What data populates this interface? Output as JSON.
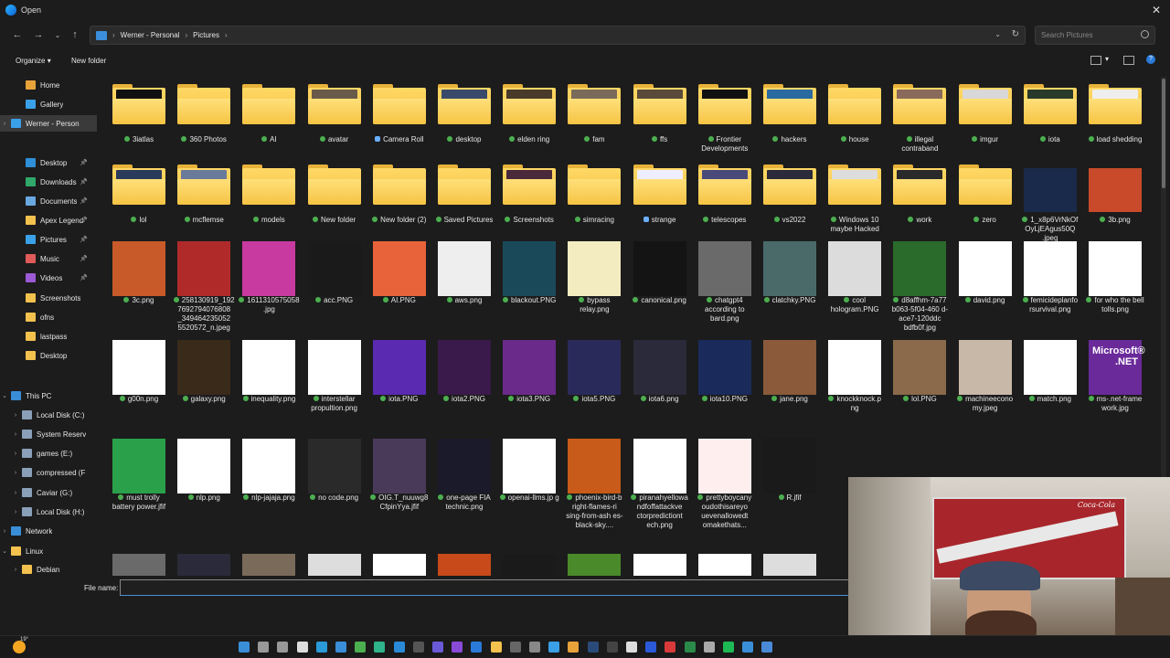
{
  "window": {
    "title": "Open"
  },
  "address": {
    "crumbs": [
      "Werner - Personal",
      "Pictures"
    ],
    "search_placeholder": "Search Pictures"
  },
  "commands": {
    "organize": "Organize",
    "new_folder": "New folder"
  },
  "nav": [
    {
      "label": "Home",
      "icon": "home-icon",
      "color": "#e8a23a"
    },
    {
      "label": "Gallery",
      "icon": "gallery-icon",
      "color": "#3aa0e8"
    },
    {
      "label": "Werner - Person",
      "icon": "cloud-icon",
      "color": "#3aa0e8",
      "selected": true,
      "expandable": true
    },
    {
      "label": "Desktop",
      "icon": "desktop-icon",
      "color": "#2f8fd8",
      "pinned": true
    },
    {
      "label": "Downloads",
      "icon": "downloads-icon",
      "color": "#2fa86a",
      "pinned": true
    },
    {
      "label": "Documents",
      "icon": "documents-icon",
      "color": "#6aa8e0",
      "pinned": true
    },
    {
      "label": "Apex Legend",
      "icon": "folder-icon",
      "color": "#f2c14e",
      "pinned": true
    },
    {
      "label": "Pictures",
      "icon": "pictures-icon",
      "color": "#3aa0e8",
      "pinned": true
    },
    {
      "label": "Music",
      "icon": "music-icon",
      "color": "#e05a5a",
      "pinned": true
    },
    {
      "label": "Videos",
      "icon": "videos-icon",
      "color": "#9b59d6",
      "pinned": true
    },
    {
      "label": "Screenshots",
      "icon": "folder-icon",
      "color": "#f2c14e"
    },
    {
      "label": "ofns",
      "icon": "folder-icon",
      "color": "#f2c14e"
    },
    {
      "label": "lastpass",
      "icon": "folder-icon",
      "color": "#f2c14e"
    },
    {
      "label": "Desktop",
      "icon": "folder-icon",
      "color": "#f2c14e"
    },
    {
      "label": "This PC",
      "icon": "pc-icon",
      "color": "#3a8ed8",
      "expanded": true
    },
    {
      "label": "Local Disk (C:)",
      "icon": "drive-icon",
      "color": "#8aa0b8",
      "expandable": true,
      "indent": true
    },
    {
      "label": "System Reserv",
      "icon": "drive-icon",
      "color": "#8aa0b8",
      "expandable": true,
      "indent": true
    },
    {
      "label": "games (E:)",
      "icon": "drive-icon",
      "color": "#8aa0b8",
      "expandable": true,
      "indent": true
    },
    {
      "label": "compressed (F",
      "icon": "drive-icon",
      "color": "#8aa0b8",
      "expandable": true,
      "indent": true
    },
    {
      "label": "Caviar (G:)",
      "icon": "drive-icon",
      "color": "#8aa0b8",
      "expandable": true,
      "indent": true
    },
    {
      "label": "Local Disk (H:)",
      "icon": "drive-icon",
      "color": "#8aa0b8",
      "expandable": true,
      "indent": true
    },
    {
      "label": "Network",
      "icon": "network-icon",
      "color": "#3a8ed8",
      "expandable": true
    },
    {
      "label": "Linux",
      "icon": "linux-icon",
      "color": "#f2c14e",
      "expanded": true
    },
    {
      "label": "Debian",
      "icon": "folder-icon",
      "color": "#f2c14e",
      "expandable": true,
      "indent": true
    }
  ],
  "items": [
    {
      "label": "3iatlas",
      "kind": "folder",
      "preview": "#111",
      "sync": "ok"
    },
    {
      "label": "360 Photos",
      "kind": "folder",
      "sync": "ok"
    },
    {
      "label": "AI",
      "kind": "folder",
      "sync": "ok"
    },
    {
      "label": "avatar",
      "kind": "folder",
      "preview": "#6a5a4a",
      "sync": "ok"
    },
    {
      "label": "Camera Roll",
      "kind": "folder",
      "sync": "cloud"
    },
    {
      "label": "desktop",
      "kind": "folder",
      "preview": "#3a4a6a",
      "sync": "ok"
    },
    {
      "label": "elden ring",
      "kind": "folder",
      "preview": "#4a3a2a",
      "sync": "ok"
    },
    {
      "label": "fam",
      "kind": "folder",
      "preview": "#7a6a5a",
      "sync": "ok"
    },
    {
      "label": "ffs",
      "kind": "folder",
      "preview": "#5a4a3a",
      "sync": "ok"
    },
    {
      "label": "Frontier Developments",
      "kind": "folder",
      "preview": "#111",
      "sync": "ok"
    },
    {
      "label": "hackers",
      "kind": "folder",
      "preview": "#2a6aa0",
      "sync": "ok"
    },
    {
      "label": "house",
      "kind": "folder",
      "sync": "ok"
    },
    {
      "label": "illegal contraband",
      "kind": "folder",
      "preview": "#8a6a5a",
      "sync": "ok"
    },
    {
      "label": "imgur",
      "kind": "folder",
      "preview": "#d8d8d8",
      "sync": "ok"
    },
    {
      "label": "iota",
      "kind": "folder",
      "preview": "#2a3a2a",
      "sync": "ok"
    },
    {
      "label": "load shedding",
      "kind": "folder",
      "preview": "#eee",
      "sync": "ok"
    },
    {
      "label": "lol",
      "kind": "folder",
      "preview": "#2a3a5a",
      "sync": "ok"
    },
    {
      "label": "mcflemse",
      "kind": "folder",
      "preview": "#6a7a9a",
      "sync": "ok"
    },
    {
      "label": "models",
      "kind": "folder",
      "sync": "ok"
    },
    {
      "label": "New folder",
      "kind": "folder",
      "sync": "ok"
    },
    {
      "label": "New folder (2)",
      "kind": "folder",
      "sync": "ok"
    },
    {
      "label": "Saved Pictures",
      "kind": "folder",
      "sync": "ok"
    },
    {
      "label": "Screenshots",
      "kind": "folder",
      "preview": "#4a2a3a",
      "sync": "ok"
    },
    {
      "label": "simracing",
      "kind": "folder",
      "sync": "ok"
    },
    {
      "label": "strange",
      "kind": "folder",
      "preview": "#eef",
      "sync": "cloud"
    },
    {
      "label": "telescopes",
      "kind": "folder",
      "preview": "#4a4a7a",
      "sync": "ok"
    },
    {
      "label": "vs2022",
      "kind": "folder",
      "preview": "#2a2a3a",
      "sync": "ok"
    },
    {
      "label": "Windows 10 maybe Hacked",
      "kind": "folder",
      "preview": "#ddd",
      "sync": "ok"
    },
    {
      "label": "work",
      "kind": "folder",
      "preview": "#2a2a2a",
      "sync": "ok"
    },
    {
      "label": "zero",
      "kind": "folder",
      "sync": "ok"
    },
    {
      "label": "1_x8p6VrNkOf OyLjEAgus50Q .jpeg",
      "kind": "image",
      "color": "#1a2a4a",
      "sync": "ok"
    },
    {
      "label": "3b.png",
      "kind": "image",
      "color": "#c84a2a",
      "sync": "ok"
    },
    {
      "label": "3c.png",
      "kind": "image",
      "color": "#c85a2a",
      "sync": "ok"
    },
    {
      "label": "258130919_192 7692794076808 _349464235052 5520572_n.jpeg",
      "kind": "image",
      "color": "#b02a2a",
      "sync": "ok"
    },
    {
      "label": "1611310575058 .jpg",
      "kind": "image",
      "color": "#c83aa0",
      "sync": "ok"
    },
    {
      "label": "acc.PNG",
      "kind": "image",
      "color": "#1a1a1a",
      "sync": "ok"
    },
    {
      "label": "AI.PNG",
      "kind": "image",
      "color": "#e8623a",
      "sync": "ok"
    },
    {
      "label": "aws.png",
      "kind": "image",
      "color": "#eeeeee",
      "sync": "ok"
    },
    {
      "label": "blackout.PNG",
      "kind": "image",
      "color": "#1a4a5a",
      "sync": "ok"
    },
    {
      "label": "bypass relay.png",
      "kind": "image",
      "color": "#f2ecc0",
      "sync": "ok"
    },
    {
      "label": "canonical.png",
      "kind": "image",
      "color": "#141414",
      "sync": "ok"
    },
    {
      "label": "chatgpt4 according to bard.png",
      "kind": "image",
      "color": "#6a6a6a",
      "sync": "ok"
    },
    {
      "label": "clatchky.PNG",
      "kind": "image",
      "color": "#4a6a6a",
      "sync": "ok"
    },
    {
      "label": "cool hologram.PNG",
      "kind": "image",
      "color": "#dcdcdc",
      "sync": "ok"
    },
    {
      "label": "d8affhm-7a77 b063-5f04-460 d-ace7-120ddc bdfb0f.jpg",
      "kind": "image",
      "color": "#2a6a2a",
      "sync": "ok"
    },
    {
      "label": "david.png",
      "kind": "image",
      "color": "#ffffff",
      "sync": "ok"
    },
    {
      "label": "femicideplanfo rsurvival.png",
      "kind": "image",
      "color": "#ffffff",
      "sync": "ok"
    },
    {
      "label": "for who the bell tolls.png",
      "kind": "image",
      "color": "#ffffff",
      "sync": "ok"
    },
    {
      "label": "g00n.png",
      "kind": "image",
      "color": "#ffffff",
      "sync": "ok"
    },
    {
      "label": "galaxy.png",
      "kind": "image",
      "color": "#3a2a1a",
      "sync": "ok"
    },
    {
      "label": "inequality.png",
      "kind": "image",
      "color": "#ffffff",
      "sync": "ok"
    },
    {
      "label": "interstellar propultion.png",
      "kind": "image",
      "color": "#ffffff",
      "sync": "ok"
    },
    {
      "label": "iota.PNG",
      "kind": "image",
      "color": "#5a2ab0",
      "sync": "ok"
    },
    {
      "label": "iota2.PNG",
      "kind": "image",
      "color": "#3a1a4a",
      "sync": "ok"
    },
    {
      "label": "iota3.PNG",
      "kind": "image",
      "color": "#6a2a8a",
      "sync": "ok"
    },
    {
      "label": "iota5.PNG",
      "kind": "image",
      "color": "#2a2a5a",
      "sync": "ok"
    },
    {
      "label": "iota6.png",
      "kind": "image",
      "color": "#2a2a3a",
      "sync": "ok"
    },
    {
      "label": "iota10.PNG",
      "kind": "image",
      "color": "#1a2a5a",
      "sync": "ok"
    },
    {
      "label": "jane.png",
      "kind": "image",
      "color": "#8a5a3a",
      "sync": "ok"
    },
    {
      "label": "knockknock.p ng",
      "kind": "image",
      "color": "#ffffff",
      "sync": "ok"
    },
    {
      "label": "lol.PNG",
      "kind": "image",
      "color": "#8a6a4a",
      "sync": "ok"
    },
    {
      "label": "machineecono my.jpeg",
      "kind": "image",
      "color": "#c8b8a8",
      "sync": "ok"
    },
    {
      "label": "match.png",
      "kind": "image",
      "color": "#ffffff",
      "sync": "ok"
    },
    {
      "label": "ms-.net-frame work.jpg",
      "kind": "image",
      "color": "#6a2a9a",
      "sync": "ok",
      "thumb_text": "Microsoft® .NET"
    },
    {
      "label": "must trolly battery power.jfif",
      "kind": "image",
      "color": "#2aa04a",
      "sync": "ok"
    },
    {
      "label": "nlp.png",
      "kind": "image",
      "color": "#ffffff",
      "sync": "ok"
    },
    {
      "label": "nlp-jajaja.png",
      "kind": "image",
      "color": "#ffffff",
      "sync": "ok"
    },
    {
      "label": "no code.png",
      "kind": "image",
      "color": "#2a2a2a",
      "sync": "ok"
    },
    {
      "label": "OIG.T_nuuwg8 CfpinYya.jfif",
      "kind": "image",
      "color": "#4a3a5a",
      "sync": "ok"
    },
    {
      "label": "one-page FIA technic.png",
      "kind": "image",
      "color": "#1a1a2a",
      "sync": "ok"
    },
    {
      "label": "openai-llms.jp g",
      "kind": "image",
      "color": "#ffffff",
      "sync": "ok"
    },
    {
      "label": "phoenix-bird-b right-flames-ri sing-from-ash es-black-sky....",
      "kind": "image",
      "color": "#c85a1a",
      "sync": "ok"
    },
    {
      "label": "piranahyellowa ndfoffattackve ctorpredictiont ech.png",
      "kind": "image",
      "color": "#ffffff",
      "sync": "ok"
    },
    {
      "label": "prettyboycany oudothisareyo uevenallowedt omakethats...",
      "kind": "image",
      "color": "#ffeeee",
      "sync": "ok"
    },
    {
      "label": "R.jfif",
      "kind": "image",
      "color": "#1a1a1a",
      "sync": "ok"
    },
    {
      "label": "",
      "kind": "image",
      "color": "#6a6a6a"
    },
    {
      "label": "",
      "kind": "image",
      "color": "#2a2a3a"
    },
    {
      "label": "",
      "kind": "image",
      "color": "#7a6a5a"
    },
    {
      "label": "",
      "kind": "image",
      "color": "#dddddd"
    },
    {
      "label": "",
      "kind": "image",
      "color": "#ffffff"
    },
    {
      "label": "",
      "kind": "image",
      "color": "#c84a1a"
    },
    {
      "label": "",
      "kind": "image",
      "color": "#1a1a1a"
    },
    {
      "label": "",
      "kind": "image",
      "color": "#4a8a2a"
    },
    {
      "label": "",
      "kind": "image",
      "color": "#ffffff"
    },
    {
      "label": "",
      "kind": "image",
      "color": "#ffffff"
    },
    {
      "label": "",
      "kind": "image",
      "color": "#dddddd"
    }
  ],
  "filename": {
    "label": "File name:",
    "value": ""
  },
  "webcam": {
    "poster_text": "Coca-Cola"
  },
  "taskbar": {
    "weather_temp": "19°",
    "icons": [
      {
        "name": "start-icon",
        "color": "#3a8ed8"
      },
      {
        "name": "search-icon",
        "color": "#999"
      },
      {
        "name": "task-view-icon",
        "color": "#999"
      },
      {
        "name": "github-icon",
        "color": "#ddd"
      },
      {
        "name": "edge-icon",
        "color": "#2a9ad8"
      },
      {
        "name": "store-icon",
        "color": "#3a8ed8"
      },
      {
        "name": "chrome-icon",
        "color": "#4caf50"
      },
      {
        "name": "edge-dev-icon",
        "color": "#2fb38a"
      },
      {
        "name": "vscode-icon",
        "color": "#2a8ad8"
      },
      {
        "name": "terminal-icon",
        "color": "#555"
      },
      {
        "name": "teams-icon",
        "color": "#6a5ad8"
      },
      {
        "name": "vs-icon",
        "color": "#8a4ad8"
      },
      {
        "name": "mail-icon",
        "color": "#2a7ad8"
      },
      {
        "name": "file-explorer-icon",
        "color": "#f2c14e"
      },
      {
        "name": "calculator-icon",
        "color": "#666"
      },
      {
        "name": "settings-icon",
        "color": "#888"
      },
      {
        "name": "photos-icon",
        "color": "#3aa0e8"
      },
      {
        "name": "chrome-alt-icon",
        "color": "#e8a23a"
      },
      {
        "name": "steam-icon",
        "color": "#2a4a7a"
      },
      {
        "name": "obs-icon",
        "color": "#444"
      },
      {
        "name": "notepad-icon",
        "color": "#ddd"
      },
      {
        "name": "word-icon",
        "color": "#2a5ad8"
      },
      {
        "name": "pdf-icon",
        "color": "#d83a3a"
      },
      {
        "name": "excel-icon",
        "color": "#2a8a4a"
      },
      {
        "name": "pen-icon",
        "color": "#aaa"
      },
      {
        "name": "spotify-icon",
        "color": "#1db954"
      },
      {
        "name": "app-icon",
        "color": "#3a8ed8"
      },
      {
        "name": "chat-icon",
        "color": "#4a8ad8"
      }
    ]
  }
}
